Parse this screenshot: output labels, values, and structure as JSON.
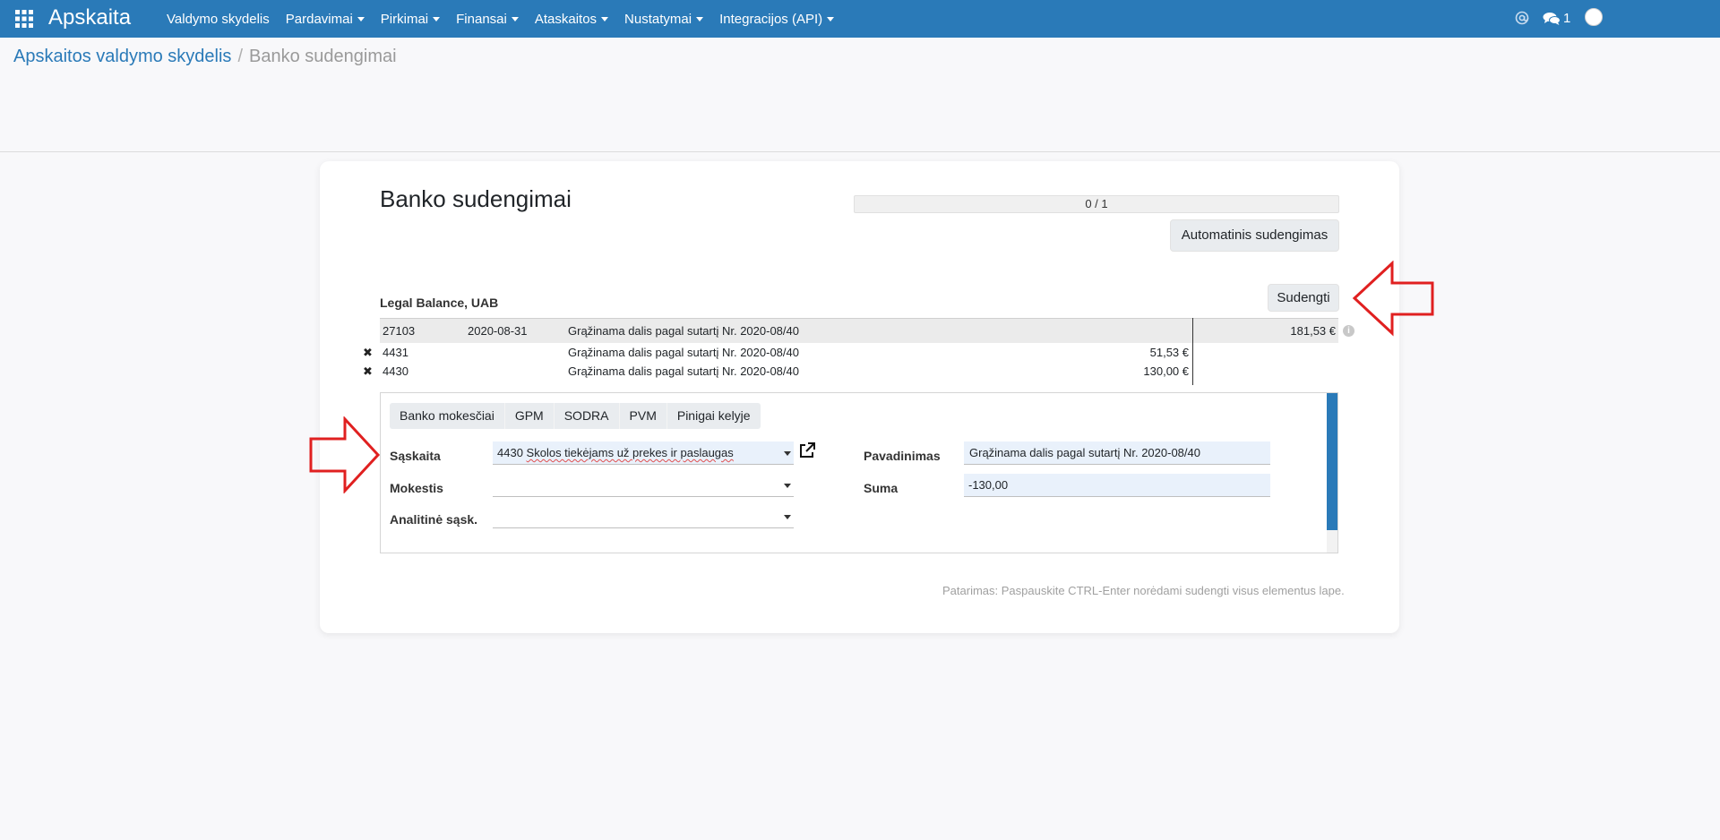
{
  "topbar": {
    "brand": "Apskaita",
    "menu": [
      {
        "label": "Valdymo skydelis",
        "dropdown": false
      },
      {
        "label": "Pardavimai",
        "dropdown": true
      },
      {
        "label": "Pirkimai",
        "dropdown": true
      },
      {
        "label": "Finansai",
        "dropdown": true
      },
      {
        "label": "Ataskaitos",
        "dropdown": true
      },
      {
        "label": "Nustatymai",
        "dropdown": true
      },
      {
        "label": "Integracijos (API)",
        "dropdown": true
      }
    ],
    "messages_count": "1",
    "accent_color": "#2a7ab8"
  },
  "breadcrumb": {
    "parent": "Apskaitos valdymo skydelis",
    "separator": "/",
    "current": "Banko sudengimai"
  },
  "sheet": {
    "title": "Banko sudengimai",
    "progress": {
      "label": "0 / 1",
      "value": 0,
      "total": 1
    },
    "auto_button": "Automatinis sudengimas",
    "partner": "Legal Balance, UAB",
    "reconcile_button": "Sudengti",
    "statement_line": {
      "ref": "27103",
      "date": "2020-08-31",
      "label": "Grąžinama dalis pagal sutartį Nr. 2020-08/40",
      "amount": "181,53 €"
    },
    "proposition_lines": [
      {
        "account": "4431",
        "label": "Grąžinama dalis pagal sutartį Nr. 2020-08/40",
        "amount": "51,53 €"
      },
      {
        "account": "4430",
        "label": "Grąžinama dalis pagal sutartį Nr. 2020-08/40",
        "amount": "130,00 €"
      }
    ],
    "tabs": [
      "Banko mokesčiai",
      "GPM",
      "SODRA",
      "PVM",
      "Pinigai kelyje"
    ],
    "form": {
      "account_label": "Sąskaita",
      "account_value_code": "4430 ",
      "account_value_text": "Skolos tiekėjams už prekes ir paslaugas",
      "tax_label": "Mokestis",
      "tax_value": "",
      "analytic_label": "Analitinė sąsk.",
      "analytic_value": "",
      "name_label": "Pavadinimas",
      "name_value": "Grąžinama dalis pagal sutartį Nr. 2020-08/40",
      "amount_label": "Suma",
      "amount_value": "-130,00"
    },
    "hint": "Patarimas: Paspauskite CTRL-Enter norėdami sudengti visus elementus lape."
  },
  "annotations": {
    "arrow_color": "#e02020"
  }
}
